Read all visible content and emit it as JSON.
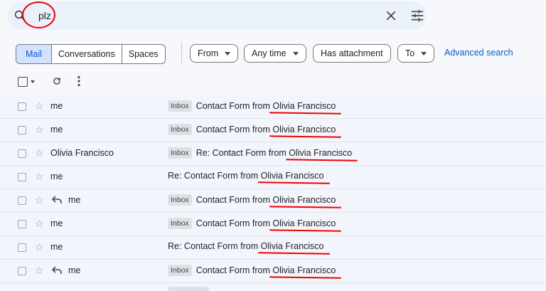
{
  "search": {
    "query": "plz",
    "icons": {
      "search": "search-icon",
      "clear": "close-icon",
      "options": "tune-icon"
    }
  },
  "filters": {
    "segments": [
      "Mail",
      "Conversations",
      "Spaces"
    ],
    "from_label": "From",
    "time_label": "Any time",
    "attachment_label": "Has attachment",
    "to_label": "To",
    "advanced_label": "Advanced search"
  },
  "toolbar": {
    "icons": [
      "checkbox",
      "chevron-down-icon",
      "refresh-icon",
      "more-vert-icon"
    ]
  },
  "emails": [
    {
      "sender": "me",
      "replied": false,
      "badge": "Inbox",
      "subject_prefix": "Contact Form from ",
      "subject_name": "Olivia Francisco"
    },
    {
      "sender": "me",
      "replied": false,
      "badge": "Inbox",
      "subject_prefix": "Contact Form from ",
      "subject_name": "Olivia Francisco"
    },
    {
      "sender": "Olivia Francisco",
      "replied": false,
      "badge": "Inbox",
      "subject_prefix": "Re: Contact Form from ",
      "subject_name": "Olivia Francisco"
    },
    {
      "sender": "me",
      "replied": false,
      "badge": "",
      "subject_prefix": "Re: Contact Form from ",
      "subject_name": "Olivia Francisco"
    },
    {
      "sender": "me",
      "replied": true,
      "badge": "Inbox",
      "subject_prefix": "Contact Form from ",
      "subject_name": "Olivia Francisco"
    },
    {
      "sender": "me",
      "replied": false,
      "badge": "Inbox",
      "subject_prefix": "Contact Form from ",
      "subject_name": "Olivia Francisco"
    },
    {
      "sender": "me",
      "replied": false,
      "badge": "",
      "subject_prefix": "Re: Contact Form from ",
      "subject_name": "Olivia Francisco"
    },
    {
      "sender": "me",
      "replied": true,
      "badge": "Inbox",
      "subject_prefix": "Contact Form from ",
      "subject_name": "Olivia Francisco"
    }
  ],
  "colors": {
    "accent": "#0b57d0",
    "annotation": "#ee0000",
    "row_bg": "#f2f6fc",
    "badge_bg": "#dde1e6"
  }
}
